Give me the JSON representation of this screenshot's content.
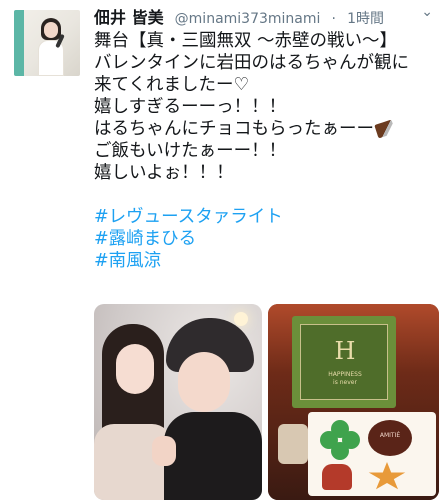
{
  "tweet": {
    "display_name": "佃井 皆美",
    "handle": "@minami373minami",
    "separator": "·",
    "time": "1時間",
    "chevron": "⌄",
    "lines": [
      "舞台【真・三國無双 〜赤壁の戦い〜】",
      "バレンタインに岩田のはるちゃんが観に",
      "来てくれましたー♡",
      "嬉しすぎるーーっ！！！",
      "はるちゃんにチョコもらったぁーー",
      "ご飯もいけたぁーー！！",
      "嬉しいよぉ！！！"
    ],
    "hashtags": [
      "#レヴュースタァライト",
      "#露崎まひる",
      "#南風涼"
    ],
    "chocolate_emoji": "chocolate-bar-icon"
  },
  "media": {
    "left_photo": "photo-two-women-selfie",
    "right_photo": "photo-chocolate-gift-box",
    "box_logo": "H",
    "box_caption_line1": "HAPPINESS",
    "box_caption_line2": "is never",
    "box_caption_line3": "",
    "choc_text": "AMITIÉ"
  },
  "colors": {
    "text": "#14171a",
    "muted": "#657786",
    "link": "#1da1f2"
  }
}
